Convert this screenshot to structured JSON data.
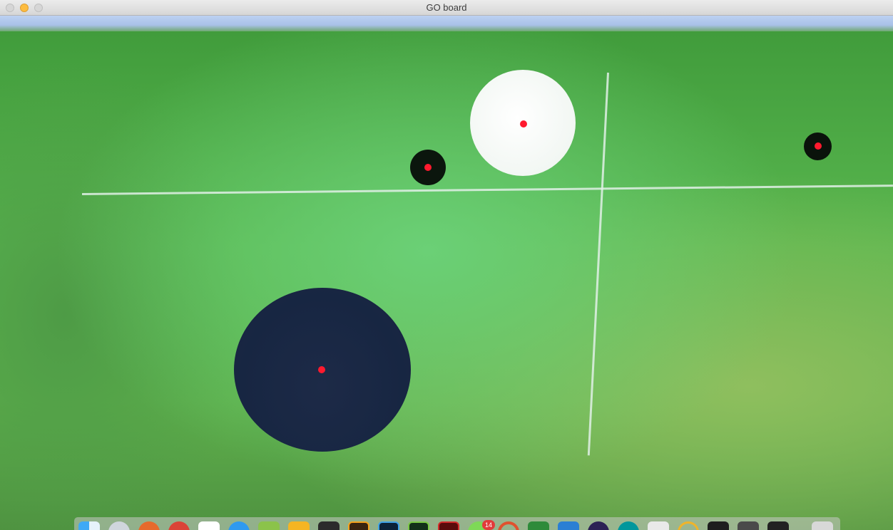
{
  "window": {
    "title": "GO board"
  },
  "board": {
    "stones": [
      {
        "id": "white-stone",
        "color": "white"
      },
      {
        "id": "black-stone-small",
        "color": "black"
      },
      {
        "id": "black-stone-right",
        "color": "black"
      },
      {
        "id": "black-stone-large",
        "color": "black"
      }
    ],
    "detection_marker_color": "#ff1a2e"
  },
  "dock": {
    "icons": [
      "finder-icon",
      "safari-icon",
      "firefox-icon",
      "chrome-icon",
      "calendar-icon",
      "app-store-icon",
      "android-studio-icon",
      "tool-icon",
      "activity-monitor-icon",
      "illustrator-icon",
      "photoshop-icon",
      "dreamweaver-icon",
      "flash-icon",
      "messages-icon",
      "swift-icon",
      "excel-icon",
      "word-icon",
      "eclipse-icon",
      "arduino-icon",
      "preview-icon",
      "keychain-icon",
      "terminal-icon",
      "sublime-text-icon",
      "console-icon",
      "trash-icon"
    ],
    "messages_badge": "14"
  }
}
